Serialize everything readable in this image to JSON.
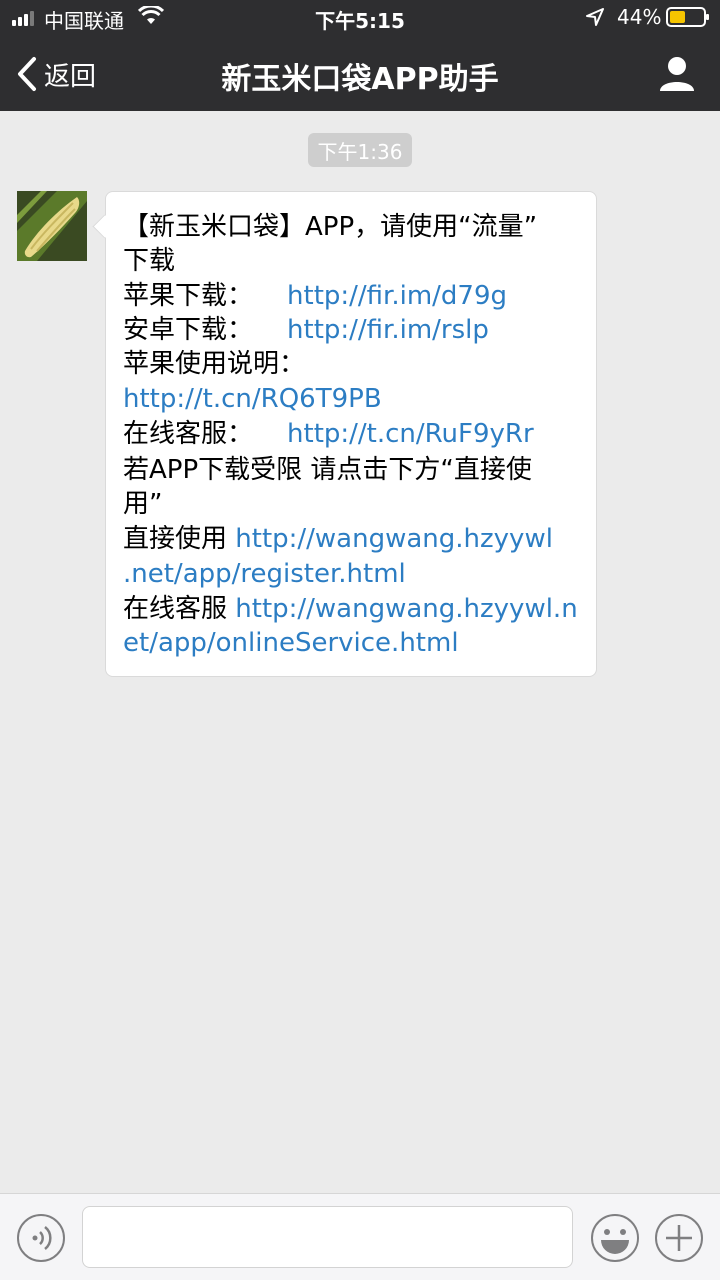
{
  "status_bar": {
    "carrier": "中国联通",
    "time": "下午5:15",
    "battery_percent": "44%"
  },
  "nav": {
    "back_label": "返回",
    "title": "新玉米口袋APP助手"
  },
  "chat": {
    "timestamp": "下午1:36",
    "message_lines": [
      {
        "text": "【新玉米口袋】APP，请使用“流量”",
        "link": ""
      },
      {
        "text": "下载",
        "link": ""
      },
      {
        "text": "苹果下载：",
        "link": "http://fir.im/d79g"
      },
      {
        "text": "安卓下载：",
        "link": "http://fir.im/rslp"
      },
      {
        "text": "苹果使用说明：",
        "link": ""
      },
      {
        "text": "",
        "link": "http://t.cn/RQ6T9PB"
      },
      {
        "text": "在线客服：",
        "link": "http://t.cn/RuF9yRr"
      },
      {
        "text": " 若APP下载受限 请点击下方“直接使",
        "link": ""
      },
      {
        "text": "用”",
        "link": ""
      },
      {
        "text": "直接使用 ",
        "link": "http://wangwang.hzyywl"
      },
      {
        "text": "",
        "link": ".net/app/register.html"
      },
      {
        "text": " 在线客服 ",
        "link": "http://wangwang.hzyywl.n"
      },
      {
        "text": "",
        "link": "et/app/onlineService.html"
      }
    ]
  },
  "icons": {
    "back": "chevron-left-icon",
    "profile": "person-icon",
    "voice": "voice-icon",
    "emoji": "emoji-icon",
    "plus": "plus-icon"
  },
  "colors": {
    "nav_bg": "#2e2e30",
    "link": "#2c7dc3",
    "chat_bg": "#ebebeb",
    "battery": "#f5c400"
  }
}
